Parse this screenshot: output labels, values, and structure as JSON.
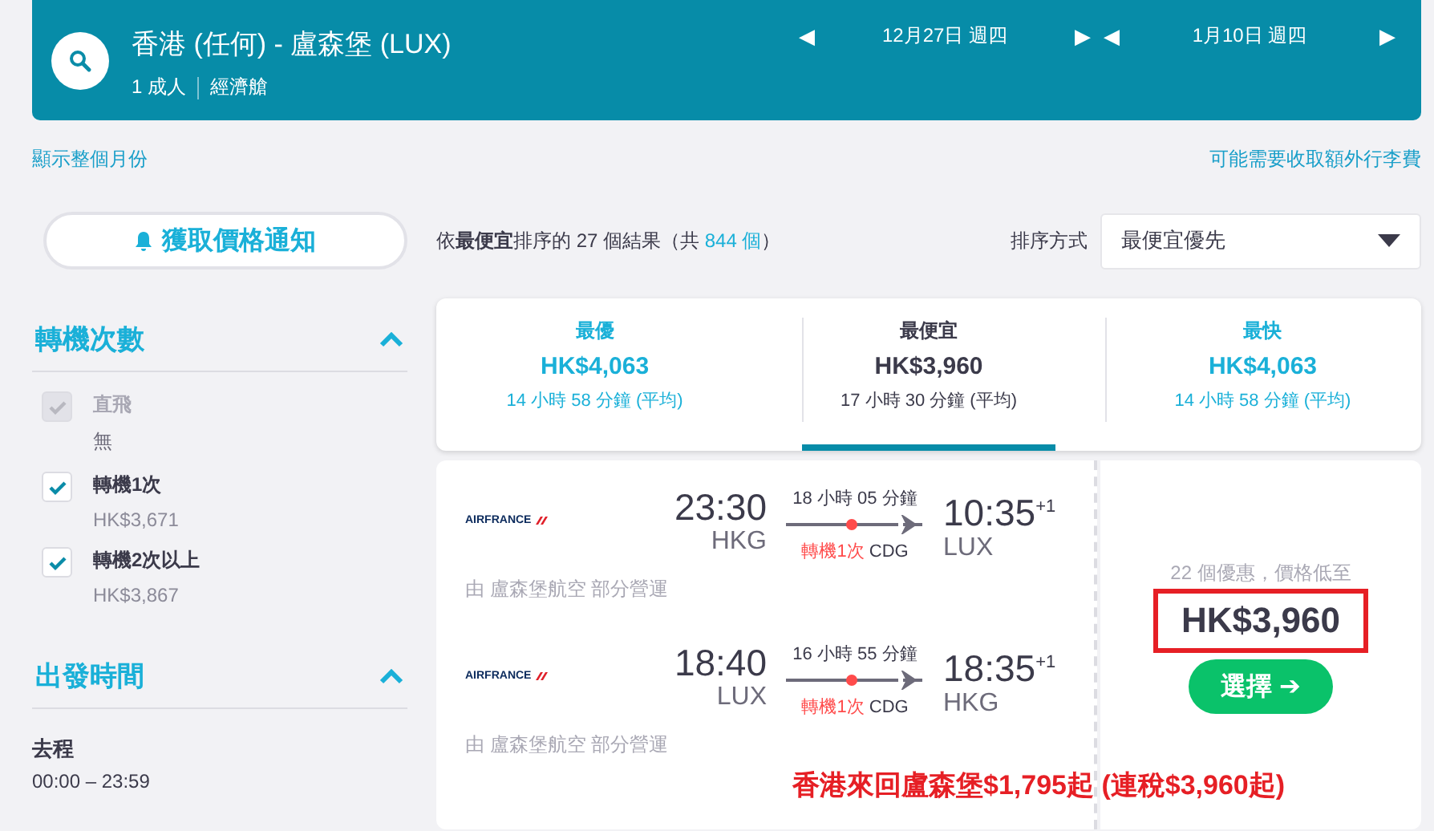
{
  "search": {
    "title": "香港 (任何) - 盧森堡 (LUX)",
    "passengers": "1 成人",
    "cabin": "經濟艙",
    "dates": [
      {
        "prev": "◀",
        "label": "12月27日 週四",
        "next": "▶"
      },
      {
        "prev": "◀",
        "label": "1月10日 週四",
        "next": "▶"
      }
    ]
  },
  "links": {
    "month": "顯示整個月份",
    "baggage": "可能需要收取額外行李費"
  },
  "alert_button": "獲取價格通知",
  "filters": [
    {
      "title": "轉機次數",
      "expanded": true,
      "options": [
        {
          "label": "直飛",
          "sub": "無",
          "checked": true,
          "disabled": true
        },
        {
          "label": "轉機1次",
          "sub": "HK$3,671",
          "checked": true,
          "disabled": false
        },
        {
          "label": "轉機2次以上",
          "sub": "HK$3,867",
          "checked": true,
          "disabled": false
        }
      ]
    },
    {
      "title": "出發時間",
      "expanded": true,
      "options": [
        {
          "label": "去程",
          "sub": "00:00 – 23:59",
          "kind": "range"
        }
      ]
    }
  ],
  "results_summary": "依**最便宜**排序的 27 個結果（共 ",
  "results_total": "844 個",
  "results_close": "）",
  "sort": {
    "label": "排序方式",
    "value": "最便宜優先"
  },
  "sort_tabs": [
    {
      "title": "最優",
      "price": "HK$4,063",
      "duration": "14 小時 58 分鐘 (平均)",
      "selected": false
    },
    {
      "title": "最便宜",
      "price": "HK$3,960",
      "duration": "17 小時 30 分鐘 (平均)",
      "selected": true
    },
    {
      "title": "最快",
      "price": "HK$4,063",
      "duration": "14 小時 58 分鐘 (平均)",
      "selected": false
    }
  ],
  "result": {
    "legs": [
      {
        "airline": "AIRFRANCE",
        "depart": "23:30",
        "from": "HKG",
        "duration": "18 小時 05 分鐘",
        "stops": "轉機1次",
        "via": "CDG",
        "arrive": "10:35",
        "day_offset": "+1",
        "to": "LUX",
        "operator": "由 盧森堡航空 部分營運"
      },
      {
        "airline": "AIRFRANCE",
        "depart": "18:40",
        "from": "LUX",
        "duration": "16 小時 55 分鐘",
        "stops": "轉機1次",
        "via": "CDG",
        "arrive": "18:35",
        "day_offset": "+1",
        "to": "HKG",
        "operator": "由 盧森堡航空 部分營運"
      }
    ],
    "deals": "22 個優惠，價格低至",
    "price": "HK$3,960",
    "select": "選擇 ➔"
  },
  "annotation": "香港來回盧森堡$1,795起 (連稅$3,960起)"
}
